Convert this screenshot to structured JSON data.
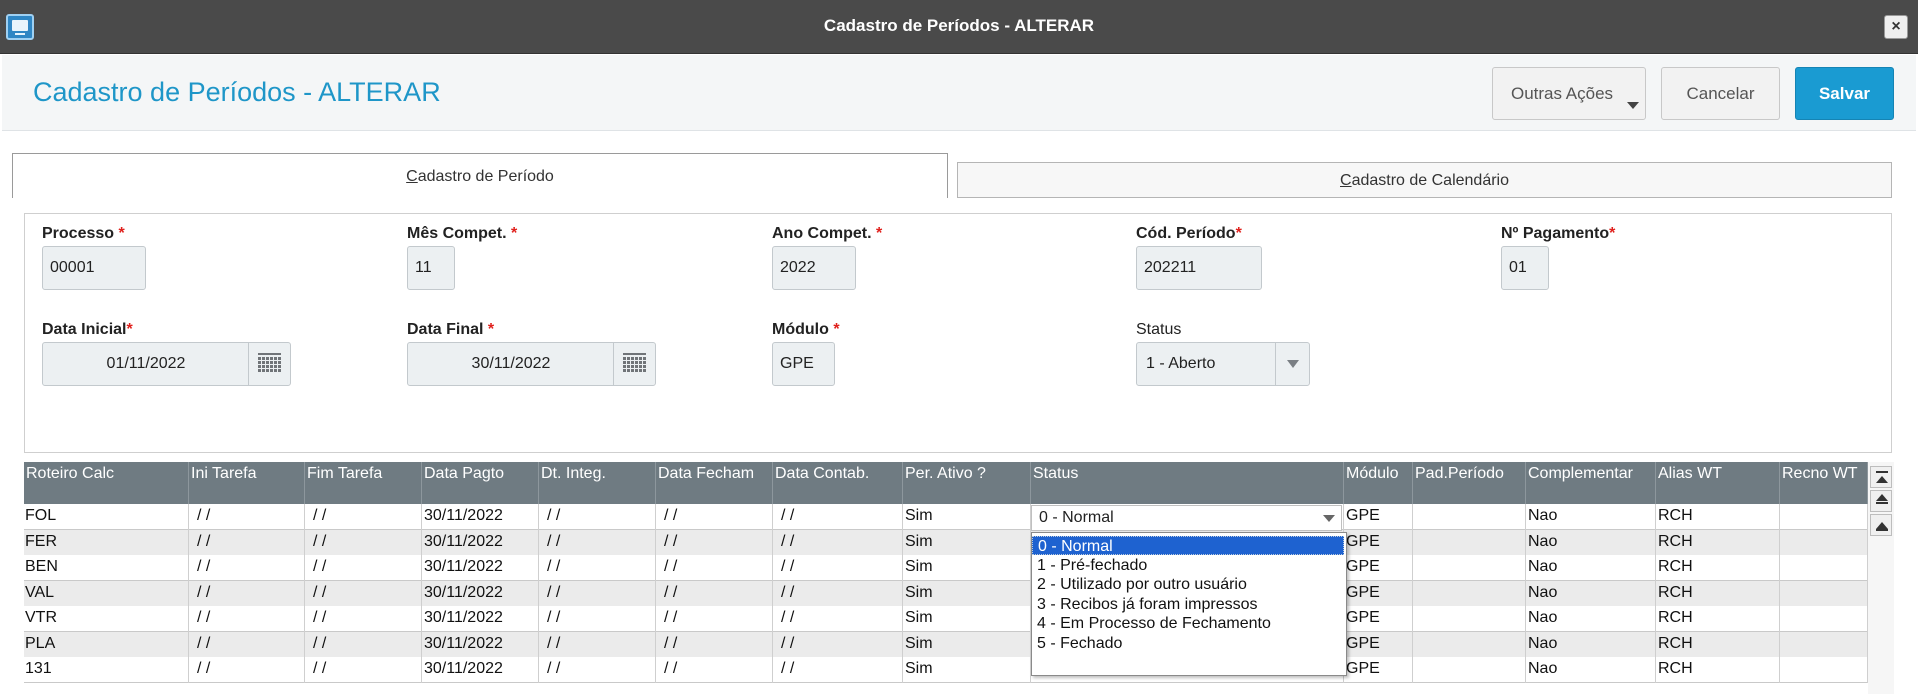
{
  "window": {
    "title": "Cadastro de Períodos - ALTERAR",
    "close_label": "×"
  },
  "header": {
    "page_title": "Cadastro de Períodos - ALTERAR",
    "buttons": {
      "outras_acoes": "Outras Ações",
      "cancelar": "Cancelar",
      "salvar": "Salvar"
    },
    "accent_color": "#1a9bd2"
  },
  "tabs": [
    {
      "hotkey": "C",
      "rest": "adastro de Período",
      "active": true
    },
    {
      "hotkey": "C",
      "rest": "adastro de Calendário",
      "active": false
    }
  ],
  "form": {
    "processo": {
      "label": "Processo",
      "required": "*",
      "value": "00001"
    },
    "mes_compet": {
      "label": "Mês Compet.",
      "required": "*",
      "value": "11"
    },
    "ano_compet": {
      "label": "Ano Compet.",
      "required": "*",
      "value": "2022"
    },
    "cod_periodo": {
      "label": "Cód. Período",
      "required": "*",
      "value": "202211"
    },
    "n_pagamento": {
      "label": "Nº Pagamento",
      "required": "*",
      "value": "01"
    },
    "data_inicial": {
      "label": "Data Inicial",
      "required": "*",
      "value": "01/11/2022"
    },
    "data_final": {
      "label": "Data Final",
      "required": "*",
      "value": "30/11/2022"
    },
    "modulo": {
      "label": "Módulo",
      "required": "*",
      "value": "GPE"
    },
    "status": {
      "label": "Status",
      "value": "1 - Aberto"
    }
  },
  "grid": {
    "columns": [
      "Roteiro Calc",
      "Ini Tarefa",
      "Fim Tarefa",
      "Data Pagto",
      "Dt. Integ.",
      "Data Fecham",
      "Data Contab.",
      "Per. Ativo ?",
      "Status",
      "Módulo",
      "Pad.Período",
      "Complementar",
      "Alias WT",
      "Recno WT"
    ],
    "rows": [
      [
        "FOL",
        " / /",
        " / /",
        "30/11/2022",
        " / /",
        " / /",
        " / /",
        "Sim",
        "0 - Normal",
        "GPE",
        "",
        "Nao",
        "RCH",
        ""
      ],
      [
        "FER",
        " / /",
        " / /",
        "30/11/2022",
        " / /",
        " / /",
        " / /",
        "Sim",
        "",
        "GPE",
        "",
        "Nao",
        "RCH",
        ""
      ],
      [
        "BEN",
        " / /",
        " / /",
        "30/11/2022",
        " / /",
        " / /",
        " / /",
        "Sim",
        "",
        "GPE",
        "",
        "Nao",
        "RCH",
        ""
      ],
      [
        "VAL",
        " / /",
        " / /",
        "30/11/2022",
        " / /",
        " / /",
        " / /",
        "Sim",
        "",
        "GPE",
        "",
        "Nao",
        "RCH",
        ""
      ],
      [
        "VTR",
        " / /",
        " / /",
        "30/11/2022",
        " / /",
        " / /",
        " / /",
        "Sim",
        "",
        "GPE",
        "",
        "Nao",
        "RCH",
        ""
      ],
      [
        "PLA",
        " / /",
        " / /",
        "30/11/2022",
        " / /",
        " / /",
        " / /",
        "Sim",
        "",
        "GPE",
        "",
        "Nao",
        "RCH",
        ""
      ],
      [
        "131",
        " / /",
        " / /",
        "30/11/2022",
        " / /",
        " / /",
        " / /",
        "Sim",
        "",
        "GPE",
        "",
        "Nao",
        "RCH",
        ""
      ]
    ]
  },
  "status_dropdown": {
    "current": "0 - Normal",
    "options": [
      "0 - Normal",
      "1 - Pré-fechado",
      "2 - Utilizado por outro usuário",
      "3 - Recibos já foram impressos",
      "4 - Em Processo de Fechamento",
      "5 - Fechado"
    ],
    "selected_index": 0
  }
}
